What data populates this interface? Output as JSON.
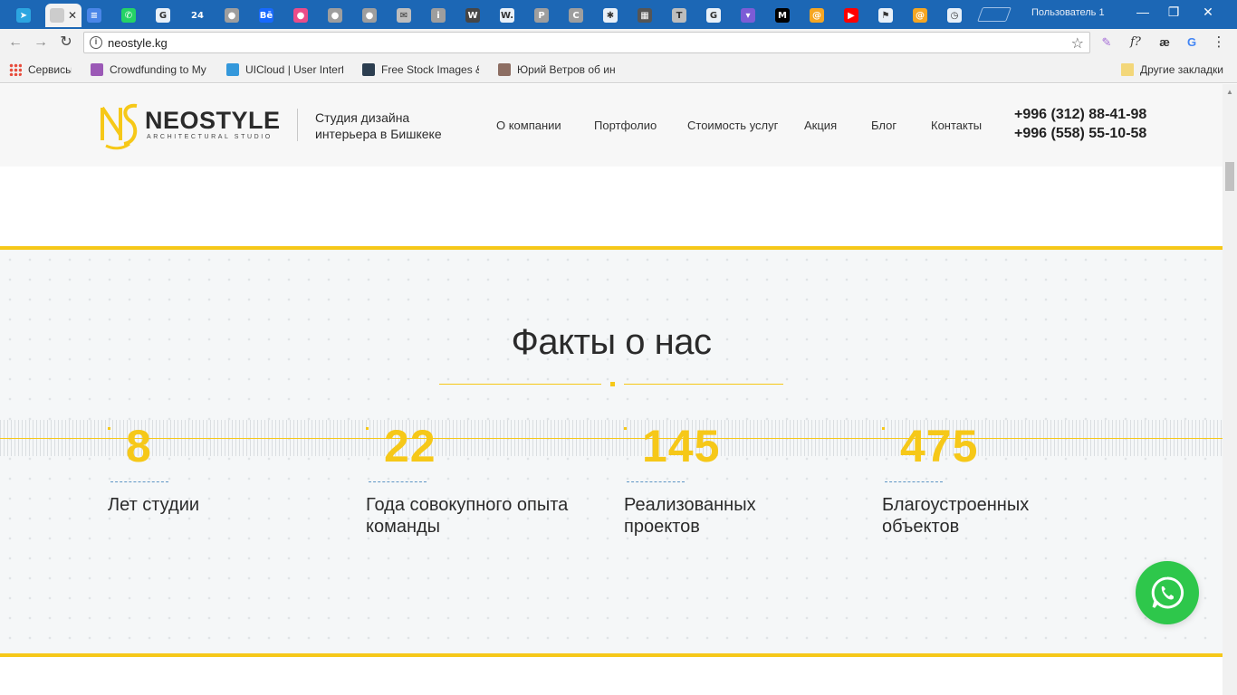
{
  "browser": {
    "url": "neostyle.kg",
    "user_label": "Пользователь 1",
    "tabs": [
      {
        "icon": "telegram-icon",
        "color": "#2ca5e0",
        "glyph": "➤"
      },
      {
        "icon": "active-tab-icon",
        "color": "#cccccc",
        "glyph": ""
      },
      {
        "icon": "docs-icon",
        "color": "#4a86e8",
        "glyph": "≡"
      },
      {
        "icon": "whatsapp-icon",
        "color": "#25d366",
        "glyph": "✆"
      },
      {
        "icon": "google-icon",
        "color": "#ffffff",
        "glyph": "G"
      },
      {
        "icon": "number-24-icon",
        "color": "#1c67b5",
        "glyph": "24"
      },
      {
        "icon": "dribbble-grey-icon",
        "color": "#9e9e9e",
        "glyph": "●"
      },
      {
        "icon": "behance-icon",
        "color": "#1769ff",
        "glyph": "Bē"
      },
      {
        "icon": "dribbble-icon",
        "color": "#ea4c89",
        "glyph": "●"
      },
      {
        "icon": "dribbble-grey-icon",
        "color": "#9e9e9e",
        "glyph": "●"
      },
      {
        "icon": "dribbble-grey-icon",
        "color": "#9e9e9e",
        "glyph": "●"
      },
      {
        "icon": "mail-grey-icon",
        "color": "#bdbdbd",
        "glyph": "✉"
      },
      {
        "icon": "info-icon",
        "color": "#9e9e9e",
        "glyph": "i"
      },
      {
        "icon": "wordpress-icon",
        "color": "#464646",
        "glyph": "W"
      },
      {
        "icon": "w-dot-icon",
        "color": "#ffffff",
        "glyph": "W."
      },
      {
        "icon": "pinterest-icon",
        "color": "#9e9e9e",
        "glyph": "P"
      },
      {
        "icon": "c-icon",
        "color": "#9e9e9e",
        "glyph": "C"
      },
      {
        "icon": "bee-icon",
        "color": "#ffffff",
        "glyph": "✱"
      },
      {
        "icon": "photo-icon",
        "color": "#555555",
        "glyph": "▦"
      },
      {
        "icon": "t-icon",
        "color": "#bdbdbd",
        "glyph": "T"
      },
      {
        "icon": "google-icon",
        "color": "#ffffff",
        "glyph": "G"
      },
      {
        "icon": "pocket-icon",
        "color": "#7c5cd6",
        "glyph": "▾"
      },
      {
        "icon": "medium-icon",
        "color": "#000000",
        "glyph": "M"
      },
      {
        "icon": "mail-at-icon",
        "color": "#f5a623",
        "glyph": "@"
      },
      {
        "icon": "youtube-icon",
        "color": "#ff0000",
        "glyph": "▶"
      },
      {
        "icon": "flag-icon",
        "color": "#ffffff",
        "glyph": "⚑"
      },
      {
        "icon": "mail-at-icon",
        "color": "#f5a623",
        "glyph": "@"
      },
      {
        "icon": "timer-icon",
        "color": "#ffffff",
        "glyph": "◷"
      }
    ],
    "bookmarks": [
      {
        "label": "Сервисы",
        "icon": "apps-grid-icon",
        "color": "#e74c3c"
      },
      {
        "label": "Crowdfunding to My",
        "icon": "crowdfunding-icon",
        "color": "#9b59b6"
      },
      {
        "label": "UICloud | User Interf",
        "icon": "cloud-icon",
        "color": "#3498db"
      },
      {
        "label": "Free Stock Images &",
        "icon": "stock-images-icon",
        "color": "#2c3e50"
      },
      {
        "label": "Юрий Ветров об ин",
        "icon": "avatar-icon",
        "color": "#8d6e63"
      }
    ],
    "other_bookmarks": "Другие закладки"
  },
  "site": {
    "brand": "NEOSTYLE",
    "brand_sub": "ARCHITECTURAL STUDIO",
    "tagline": [
      "Студия дизайна",
      "интерьера в Бишкеке"
    ],
    "menu": [
      "О компании",
      "Портфолио",
      "Стоимость услуг",
      "Акция",
      "Блог",
      "Контакты"
    ],
    "phones": [
      "+996 (312) 88-41-98",
      "+996 (558) 55-10-58"
    ],
    "accent": "#f6c818",
    "facts_title": "Факты о нас",
    "stats": [
      {
        "value": "8",
        "label": [
          "Лет студии"
        ]
      },
      {
        "value": "22",
        "label": [
          "Года совокупного опыта",
          "команды"
        ]
      },
      {
        "value": "145",
        "label": [
          "Реализованных",
          "проектов"
        ]
      },
      {
        "value": "475",
        "label": [
          "Благоустроенных",
          "объектов"
        ]
      }
    ]
  }
}
